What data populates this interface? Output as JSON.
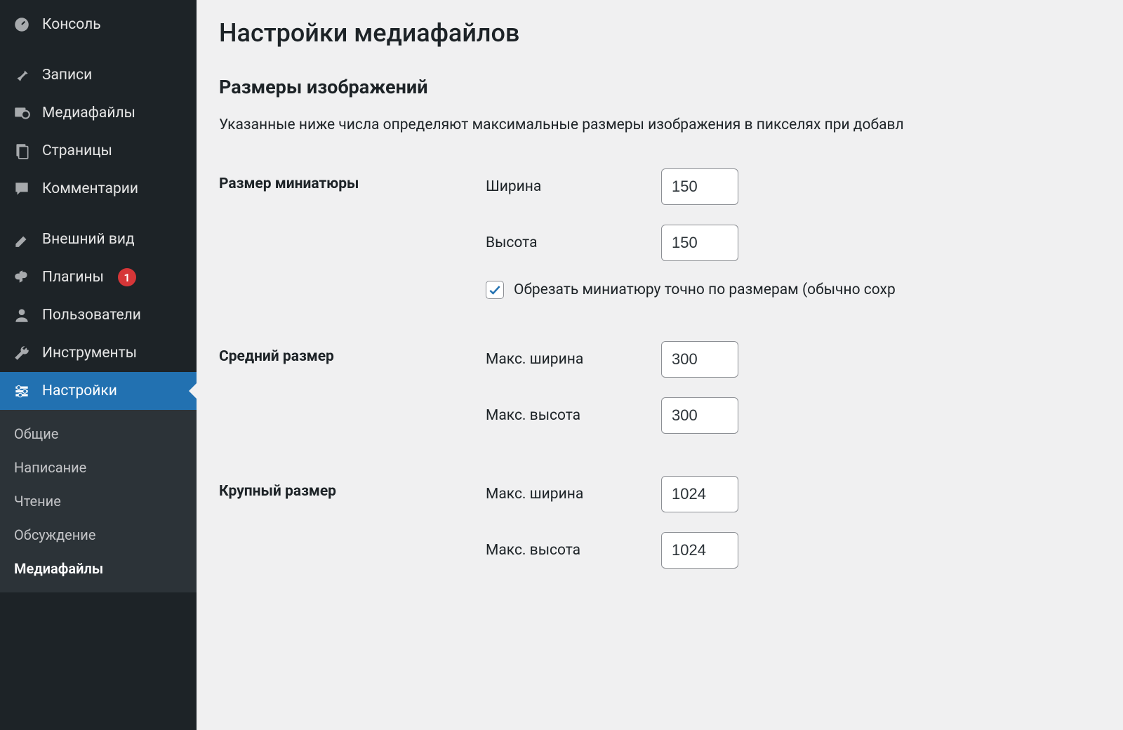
{
  "sidebar": {
    "items": [
      {
        "label": "Консоль",
        "icon": "dashboard"
      },
      {
        "label": "Записи",
        "icon": "pin"
      },
      {
        "label": "Медиафайлы",
        "icon": "media"
      },
      {
        "label": "Страницы",
        "icon": "pages"
      },
      {
        "label": "Комментарии",
        "icon": "comments"
      },
      {
        "label": "Внешний вид",
        "icon": "appearance"
      },
      {
        "label": "Плагины",
        "icon": "plugins",
        "badge": "1"
      },
      {
        "label": "Пользователи",
        "icon": "users"
      },
      {
        "label": "Инструменты",
        "icon": "tools"
      },
      {
        "label": "Настройки",
        "icon": "settings",
        "current": true
      }
    ],
    "submenu": [
      {
        "label": "Общие"
      },
      {
        "label": "Написание"
      },
      {
        "label": "Чтение"
      },
      {
        "label": "Обсуждение"
      },
      {
        "label": "Медиафайлы",
        "current": true
      }
    ]
  },
  "page": {
    "title": "Настройки медиафайлов",
    "section_title": "Размеры изображений",
    "description": "Указанные ниже числа определяют максимальные размеры изображения в пикселях при добавл"
  },
  "thumb": {
    "heading": "Размер миниатюры",
    "width_label": "Ширина",
    "width_value": "150",
    "height_label": "Высота",
    "height_value": "150",
    "crop_label": "Обрезать миниатюру точно по размерам (обычно сохр",
    "crop_checked": true
  },
  "medium": {
    "heading": "Средний размер",
    "width_label": "Макс. ширина",
    "width_value": "300",
    "height_label": "Макс. высота",
    "height_value": "300"
  },
  "large": {
    "heading": "Крупный размер",
    "width_label": "Макс. ширина",
    "width_value": "1024",
    "height_label": "Макс. высота",
    "height_value": "1024"
  }
}
